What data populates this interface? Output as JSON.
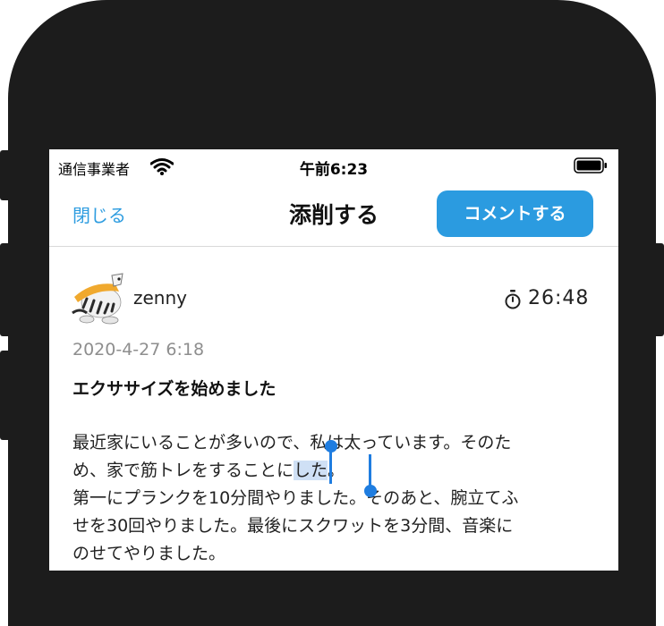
{
  "status_bar": {
    "carrier": "通信事業者",
    "time": "午前6:23",
    "wifi_icon": "wifi-icon",
    "battery_icon": "battery-icon"
  },
  "nav": {
    "close_label": "閉じる",
    "title": "添削する",
    "comment_label": "コメントする"
  },
  "post": {
    "username": "zenny",
    "avatar_icon": "tiger-avatar",
    "timer_icon": "stopwatch-icon",
    "timer": "26:48",
    "date": "2020-4-27 6:18",
    "title": "エクササイズを始めました",
    "body": {
      "line1": "最近家にいることが多いので、私は太っています。そのた",
      "line2_before": "め、家で筋トレをすることに",
      "line2_selected": "した",
      "line2_after": "。",
      "line3": "第一にプランクを10分間やりました。そのあと、腕立てふ",
      "line4": "せを30回やりました。最後にスクワットを3分間、音楽に",
      "line5": "のせてやりました。"
    }
  },
  "colors": {
    "accent": "#2b9be0",
    "link": "#2f9de0",
    "selection": "#cfe0f5",
    "selection_handle": "#1f7de0",
    "frame": "#1c1c1c"
  }
}
